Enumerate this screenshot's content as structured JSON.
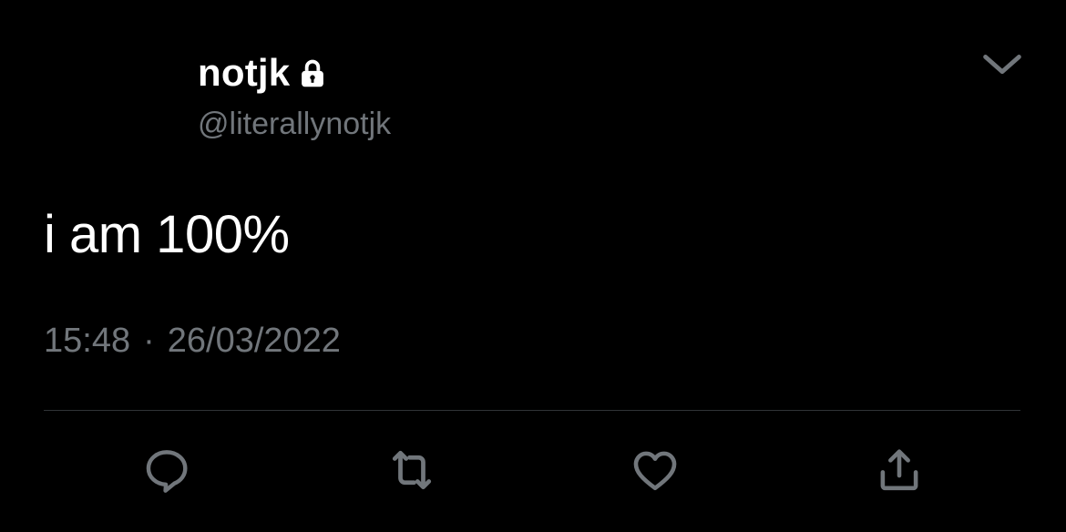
{
  "author": {
    "display_name": "notjk",
    "handle": "@literallynotjk",
    "protected_icon": "lock-icon"
  },
  "tweet": {
    "text": "i am 100%",
    "time": "15:48",
    "separator": "·",
    "date": "26/03/2022"
  },
  "actions": {
    "reply_icon": "reply-icon",
    "retweet_icon": "retweet-icon",
    "like_icon": "heart-icon",
    "share_icon": "share-icon",
    "menu_icon": "chevron-down-icon"
  },
  "colors": {
    "background": "#000000",
    "primary_text": "#ffffff",
    "secondary_text": "#71767b",
    "divider": "#2f3336",
    "icon": "#71767b"
  }
}
